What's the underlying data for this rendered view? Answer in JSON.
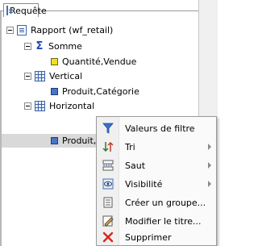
{
  "tab": {
    "label": "Requête"
  },
  "tree": {
    "root": {
      "label": "Rapport (wf_retail)"
    },
    "somme": {
      "label": "Somme",
      "child": "Quantité,Vendue"
    },
    "vertical": {
      "label": "Vertical",
      "child": "Produit,Catégorie"
    },
    "horizontal": {
      "label": "Horizontal",
      "child": "Produit,Sous-catégorie"
    }
  },
  "context_menu": {
    "items": [
      {
        "label": "Valeurs de filtre",
        "icon": "filter-icon",
        "submenu": false
      },
      {
        "label": "Tri",
        "icon": "sort-icon",
        "submenu": true
      },
      {
        "label": "Saut",
        "icon": "break-icon",
        "submenu": true
      },
      {
        "label": "Visibilité",
        "icon": "visibility-icon",
        "submenu": true
      },
      {
        "label": "Créer un groupe...",
        "icon": "group-icon",
        "submenu": false
      },
      {
        "label": "Modifier le titre...",
        "icon": "edit-title-icon",
        "submenu": false
      },
      {
        "label": "Supprimer",
        "icon": "delete-icon",
        "submenu": false
      }
    ]
  }
}
